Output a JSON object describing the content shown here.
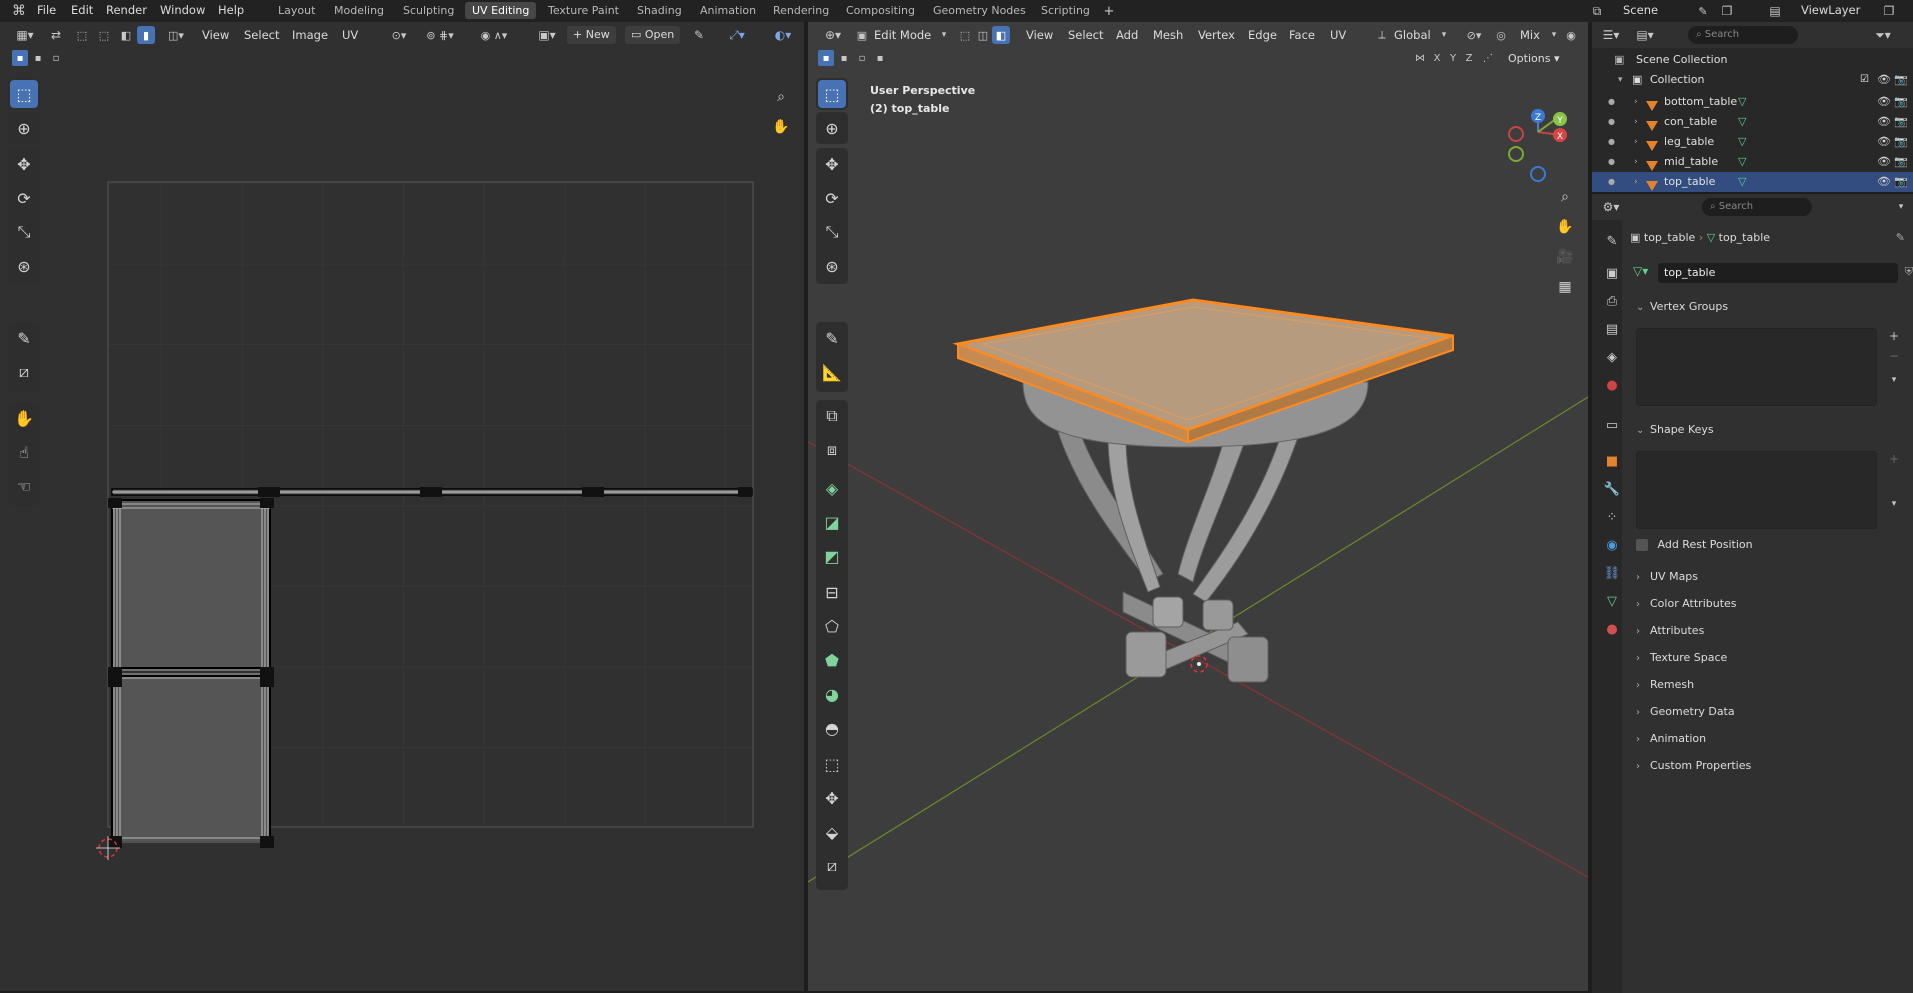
{
  "menu": {
    "file": "File",
    "edit": "Edit",
    "render": "Render",
    "window": "Window",
    "help": "Help"
  },
  "workspaces": [
    "Layout",
    "Modeling",
    "Sculpting",
    "UV Editing",
    "Texture Paint",
    "Shading",
    "Animation",
    "Rendering",
    "Compositing",
    "Geometry Nodes",
    "Scripting"
  ],
  "active_workspace": "UV Editing",
  "scene": "Scene",
  "view_layer": "ViewLayer",
  "uv_editor": {
    "menus": {
      "view": "View",
      "select": "Select",
      "image": "Image",
      "uv": "UV"
    },
    "new_label": "New",
    "open_label": "Open"
  },
  "viewport": {
    "mode": "Edit Mode",
    "menus": {
      "view": "View",
      "select": "Select",
      "add": "Add",
      "mesh": "Mesh",
      "vertex": "Vertex",
      "edge": "Edge",
      "face": "Face",
      "uv": "UV"
    },
    "orientation": "Global",
    "blend": "Mix",
    "options_label": "Options",
    "info_title": "User Perspective",
    "info_object": "(2) top_table",
    "axis_x": "X",
    "axis_y": "Y",
    "axis_z": "Z"
  },
  "outliner": {
    "search_placeholder": "Search",
    "scene_collection": "Scene Collection",
    "collection": "Collection",
    "objects": [
      {
        "name": "bottom_table"
      },
      {
        "name": "con_table"
      },
      {
        "name": "leg_table"
      },
      {
        "name": "mid_table"
      },
      {
        "name": "top_table"
      }
    ],
    "selected": "top_table"
  },
  "properties": {
    "search_placeholder": "Search",
    "breadcrumb_object": "top_table",
    "breadcrumb_mesh": "top_table",
    "mesh_name": "top_table",
    "vertex_groups": "Vertex Groups",
    "shape_keys": "Shape Keys",
    "add_rest_position": "Add Rest Position",
    "collapsed_panels": [
      "UV Maps",
      "Color Attributes",
      "Attributes",
      "Texture Space",
      "Remesh",
      "Geometry Data",
      "Animation",
      "Custom Properties"
    ]
  },
  "colors": {
    "accent": "#4772b3",
    "selection_orange": "#ff8a1f",
    "mesh_data_green": "#5fd18a",
    "object_orange": "#e3832b"
  }
}
